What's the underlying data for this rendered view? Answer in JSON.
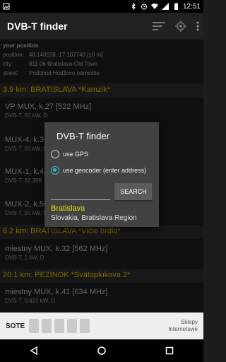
{
  "status_bar": {
    "time": "12:51"
  },
  "app_bar": {
    "title": "DVB-T finder"
  },
  "position": {
    "header": "your position",
    "rows": [
      {
        "key": "position:",
        "value": "48.148598, 17.107748 [±0 m]"
      },
      {
        "key": "city:",
        "value": "811 06 Bratislava-Old Town"
      },
      {
        "key": "street:",
        "value": "Podchod Hodžovo námestie"
      }
    ]
  },
  "groups": [
    {
      "title": "3.9 km: BRATISLAVA *Kamzík*"
    },
    {
      "title": "6.2 km: BRATISLAVA *Vičie hrdlo*"
    },
    {
      "title": "20.1 km: PEZINOK *Svätoplukova 2*"
    }
  ],
  "items": [
    {
      "name": "VP MUX, k.27 [522 MHz]",
      "sub": "DVB-T, 50 kW, D"
    },
    {
      "name": "MUX-4, k.39",
      "sub": "DVB-T, 50 kW, D"
    },
    {
      "name": "MUX-1, k.44",
      "sub": "DVB-T, 32.359"
    },
    {
      "name": "MUX-2, k.56",
      "sub": "DVB-T, 50 kW, D"
    },
    {
      "name": "miestny MUX, k.32 [562 MHz]",
      "sub": "DVB-T, 1 kW, D"
    },
    {
      "name": "miestny MUX, k.41 [634 MHz]",
      "sub": "DVB-T, 0.422 kW, D"
    }
  ],
  "dialog": {
    "title": "DVB-T finder",
    "option_gps": "use GPS",
    "option_geocoder": "use geocoder (enter address)",
    "address_value": "",
    "search_label": "SEARCH",
    "result_name": "Bratislava",
    "result_region": "Slovakia, Bratislava Region"
  },
  "ad": {
    "brand": "SOTE",
    "text": "Sklepy Internetowe"
  },
  "colors": {
    "accent": "#e8c200",
    "radio": "#39b6b6",
    "result": "#e8e000"
  }
}
